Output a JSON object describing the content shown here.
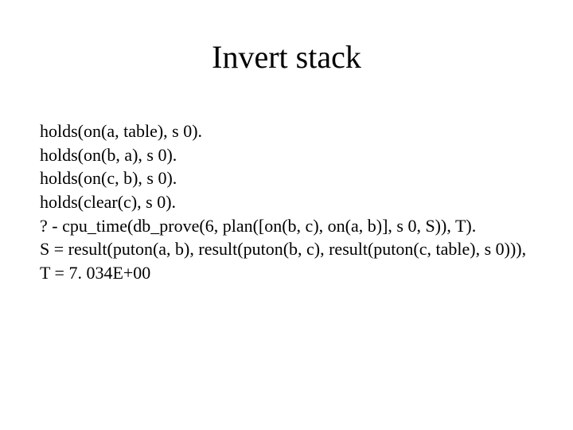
{
  "title": "Invert stack",
  "lines": {
    "l0": "holds(on(a, table), s 0).",
    "l1": "holds(on(b, a), s 0).",
    "l2": "holds(on(c, b), s 0).",
    "l3": "holds(clear(c), s 0).",
    "l4": "? - cpu_time(db_prove(6, plan([on(b, c), on(a, b)], s 0, S)), T).",
    "l5": "S = result(puton(a, b), result(puton(b, c), result(puton(c, table), s 0))),",
    "l6": "T = 7. 034E+00"
  }
}
